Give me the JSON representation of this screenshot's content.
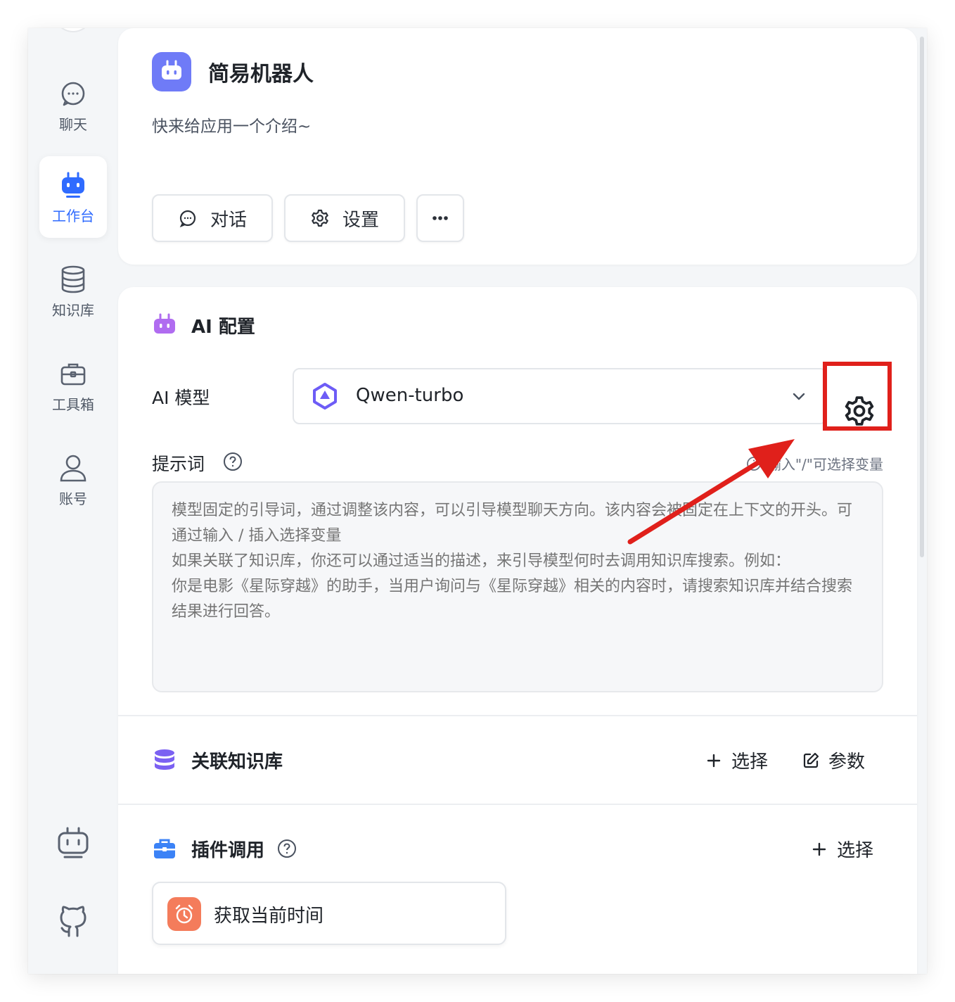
{
  "sidebar": {
    "items": [
      {
        "label": "聊天",
        "icon": "chat-icon"
      },
      {
        "label": "工作台",
        "icon": "robot-icon",
        "active": true
      },
      {
        "label": "知识库",
        "icon": "database-icon"
      },
      {
        "label": "工具箱",
        "icon": "toolbox-icon"
      },
      {
        "label": "账号",
        "icon": "user-icon"
      }
    ],
    "footer_icons": [
      "robot-icon",
      "github-icon"
    ]
  },
  "app": {
    "title": "简易机器人",
    "description": "快来给应用一个介绍~",
    "buttons": {
      "chat": "对话",
      "settings": "设置"
    }
  },
  "ai_config": {
    "title": "AI 配置",
    "model_label": "AI 模型",
    "model_value": "Qwen-turbo",
    "prompt_label": "提示词",
    "prompt_hint": "输入\"/\"可选择变量",
    "prompt_placeholder": "模型固定的引导词，通过调整该内容，可以引导模型聊天方向。该内容会被固定在上下文的开头。可通过输入 / 插入选择变量\n如果关联了知识库，你还可以通过适当的描述，来引导模型何时去调用知识库搜索。例如：\n你是电影《星际穿越》的助手，当用户询问与《星际穿越》相关的内容时，请搜索知识库并结合搜索结果进行回答。"
  },
  "knowledge": {
    "title": "关联知识库",
    "select_label": "选择",
    "params_label": "参数"
  },
  "plugins": {
    "title": "插件调用",
    "select_label": "选择",
    "items": [
      {
        "name": "获取当前时间",
        "icon": "alarm-clock-icon"
      }
    ]
  },
  "colors": {
    "accent": "#2f6bff",
    "app_icon_bg": "#6f7bf7",
    "highlight": "#e0201b",
    "plugin_icon_bg": "#f47c5b"
  }
}
